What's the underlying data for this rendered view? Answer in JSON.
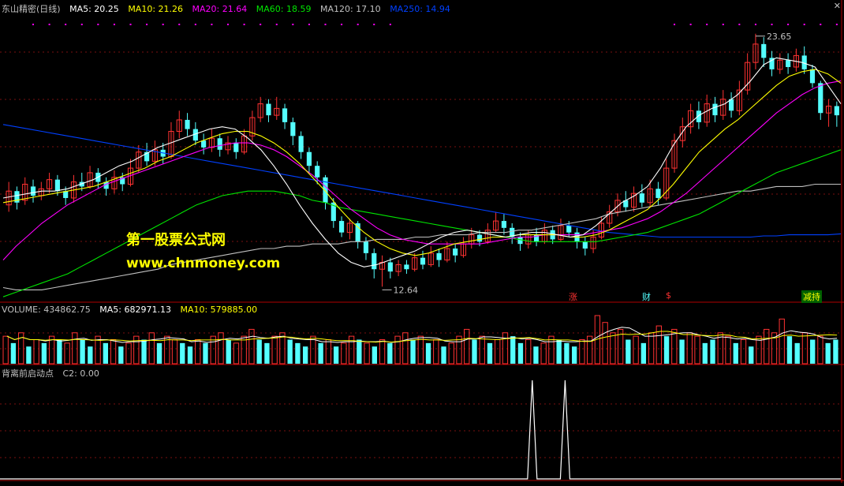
{
  "main_header": {
    "title": "东山精密(日线)",
    "ma5": "MA5: 20.25",
    "ma10": "MA10: 21.26",
    "ma20": "MA20: 21.64",
    "ma60": "MA60: 18.59",
    "ma120": "MA120: 17.10",
    "ma250": "MA250: 14.94"
  },
  "volume_header": {
    "title": "VOLUME: 434862.75",
    "ma5": "MA5: 682971.13",
    "ma10": "MA10: 579885.00"
  },
  "indicator_header": {
    "title": "背离前启动点",
    "c2": "C2: 0.00"
  },
  "watermark": {
    "line1": "第一股票公式网",
    "line2": "www.chnmoney.com"
  },
  "annotations": {
    "high_label": "23.65",
    "low_label": "12.64",
    "tag_zhang": "涨",
    "tag_cai": "财",
    "tag_s": "$",
    "tag_jianchi": "减持"
  },
  "colors": {
    "up": "#ff3232",
    "down": "#54ffff",
    "ma5": "#ffffff",
    "ma10": "#ffff00",
    "ma20": "#ff00ff",
    "ma60": "#00e600",
    "ma120": "#c0c0c0",
    "ma250": "#0040ff",
    "grid": "#7a1010"
  },
  "chart_data": {
    "type": "candlestick",
    "title": "东山精密(日线)",
    "ylim": [
      12.0,
      24.5
    ],
    "high": 23.65,
    "low": 12.64,
    "bars": [
      {
        "o": 16.2,
        "c": 16.8,
        "h": 17.2,
        "l": 15.9
      },
      {
        "o": 16.8,
        "c": 16.3,
        "h": 17.0,
        "l": 16.0
      },
      {
        "o": 16.4,
        "c": 17.1,
        "h": 17.4,
        "l": 16.2
      },
      {
        "o": 17.0,
        "c": 16.6,
        "h": 17.3,
        "l": 16.3
      },
      {
        "o": 16.6,
        "c": 16.9,
        "h": 17.2,
        "l": 16.4
      },
      {
        "o": 16.9,
        "c": 17.3,
        "h": 17.6,
        "l": 16.7
      },
      {
        "o": 17.3,
        "c": 16.8,
        "h": 17.5,
        "l": 16.6
      },
      {
        "o": 16.8,
        "c": 16.5,
        "h": 17.0,
        "l": 16.2
      },
      {
        "o": 16.5,
        "c": 17.2,
        "h": 17.5,
        "l": 16.3
      },
      {
        "o": 17.2,
        "c": 17.0,
        "h": 17.6,
        "l": 16.8
      },
      {
        "o": 17.0,
        "c": 17.6,
        "h": 17.9,
        "l": 16.9
      },
      {
        "o": 17.6,
        "c": 17.2,
        "h": 17.8,
        "l": 16.9
      },
      {
        "o": 17.2,
        "c": 16.9,
        "h": 17.4,
        "l": 16.6
      },
      {
        "o": 16.9,
        "c": 17.4,
        "h": 17.7,
        "l": 16.7
      },
      {
        "o": 17.4,
        "c": 17.1,
        "h": 17.6,
        "l": 16.8
      },
      {
        "o": 17.1,
        "c": 17.8,
        "h": 18.2,
        "l": 17.0
      },
      {
        "o": 17.8,
        "c": 18.5,
        "h": 18.8,
        "l": 17.6
      },
      {
        "o": 18.5,
        "c": 18.1,
        "h": 18.9,
        "l": 17.9
      },
      {
        "o": 18.1,
        "c": 18.6,
        "h": 19.0,
        "l": 17.9
      },
      {
        "o": 18.6,
        "c": 18.3,
        "h": 18.9,
        "l": 18.0
      },
      {
        "o": 18.3,
        "c": 19.4,
        "h": 19.8,
        "l": 18.2
      },
      {
        "o": 19.4,
        "c": 19.9,
        "h": 20.3,
        "l": 19.1
      },
      {
        "o": 19.9,
        "c": 19.5,
        "h": 20.2,
        "l": 19.2
      },
      {
        "o": 19.5,
        "c": 19.0,
        "h": 19.8,
        "l": 18.8
      },
      {
        "o": 19.0,
        "c": 18.7,
        "h": 19.3,
        "l": 18.4
      },
      {
        "o": 18.7,
        "c": 19.1,
        "h": 19.5,
        "l": 18.5
      },
      {
        "o": 19.1,
        "c": 18.6,
        "h": 19.3,
        "l": 18.3
      },
      {
        "o": 18.6,
        "c": 18.9,
        "h": 19.2,
        "l": 18.4
      },
      {
        "o": 18.9,
        "c": 18.5,
        "h": 19.1,
        "l": 18.2
      },
      {
        "o": 18.5,
        "c": 19.2,
        "h": 19.5,
        "l": 18.4
      },
      {
        "o": 19.2,
        "c": 20.0,
        "h": 20.3,
        "l": 19.0
      },
      {
        "o": 20.0,
        "c": 20.6,
        "h": 20.9,
        "l": 19.8
      },
      {
        "o": 20.6,
        "c": 20.1,
        "h": 20.8,
        "l": 19.8
      },
      {
        "o": 20.1,
        "c": 20.4,
        "h": 20.9,
        "l": 19.9
      },
      {
        "o": 20.4,
        "c": 19.8,
        "h": 20.6,
        "l": 19.5
      },
      {
        "o": 19.8,
        "c": 19.2,
        "h": 20.0,
        "l": 18.8
      },
      {
        "o": 19.2,
        "c": 18.5,
        "h": 19.4,
        "l": 18.2
      },
      {
        "o": 18.5,
        "c": 17.9,
        "h": 18.7,
        "l": 17.6
      },
      {
        "o": 17.9,
        "c": 17.4,
        "h": 18.1,
        "l": 17.1
      },
      {
        "o": 17.4,
        "c": 16.3,
        "h": 17.5,
        "l": 16.0
      },
      {
        "o": 16.3,
        "c": 15.5,
        "h": 16.5,
        "l": 15.2
      },
      {
        "o": 15.5,
        "c": 15.0,
        "h": 15.7,
        "l": 14.8
      },
      {
        "o": 15.0,
        "c": 15.4,
        "h": 15.6,
        "l": 14.7
      },
      {
        "o": 15.4,
        "c": 14.6,
        "h": 15.5,
        "l": 14.3
      },
      {
        "o": 14.6,
        "c": 14.1,
        "h": 14.8,
        "l": 13.8
      },
      {
        "o": 14.1,
        "c": 13.4,
        "h": 14.3,
        "l": 13.0
      },
      {
        "o": 13.4,
        "c": 13.7,
        "h": 14.0,
        "l": 12.64
      },
      {
        "o": 13.7,
        "c": 13.3,
        "h": 13.9,
        "l": 13.0
      },
      {
        "o": 13.3,
        "c": 13.6,
        "h": 13.8,
        "l": 13.1
      },
      {
        "o": 13.6,
        "c": 13.4,
        "h": 13.8,
        "l": 13.2
      },
      {
        "o": 13.4,
        "c": 13.9,
        "h": 14.1,
        "l": 13.3
      },
      {
        "o": 13.9,
        "c": 13.6,
        "h": 14.2,
        "l": 13.4
      },
      {
        "o": 13.6,
        "c": 14.1,
        "h": 14.4,
        "l": 13.5
      },
      {
        "o": 14.1,
        "c": 13.8,
        "h": 14.3,
        "l": 13.5
      },
      {
        "o": 13.8,
        "c": 14.3,
        "h": 14.6,
        "l": 13.7
      },
      {
        "o": 14.3,
        "c": 14.0,
        "h": 14.5,
        "l": 13.7
      },
      {
        "o": 14.0,
        "c": 14.5,
        "h": 14.8,
        "l": 13.9
      },
      {
        "o": 14.5,
        "c": 14.9,
        "h": 15.2,
        "l": 14.3
      },
      {
        "o": 14.9,
        "c": 14.6,
        "h": 15.1,
        "l": 14.4
      },
      {
        "o": 14.6,
        "c": 15.1,
        "h": 15.4,
        "l": 14.5
      },
      {
        "o": 15.1,
        "c": 15.5,
        "h": 15.9,
        "l": 15.0
      },
      {
        "o": 15.5,
        "c": 15.2,
        "h": 15.8,
        "l": 14.9
      },
      {
        "o": 15.2,
        "c": 14.8,
        "h": 15.4,
        "l": 14.5
      },
      {
        "o": 14.8,
        "c": 14.5,
        "h": 15.0,
        "l": 14.2
      },
      {
        "o": 14.5,
        "c": 14.9,
        "h": 15.1,
        "l": 14.3
      },
      {
        "o": 14.9,
        "c": 14.6,
        "h": 15.2,
        "l": 14.4
      },
      {
        "o": 14.6,
        "c": 15.1,
        "h": 15.4,
        "l": 14.5
      },
      {
        "o": 15.1,
        "c": 14.7,
        "h": 15.3,
        "l": 14.5
      },
      {
        "o": 14.7,
        "c": 15.3,
        "h": 15.6,
        "l": 14.6
      },
      {
        "o": 15.3,
        "c": 15.0,
        "h": 15.5,
        "l": 14.8
      },
      {
        "o": 15.0,
        "c": 14.6,
        "h": 15.2,
        "l": 14.3
      },
      {
        "o": 14.6,
        "c": 14.3,
        "h": 14.8,
        "l": 14.0
      },
      {
        "o": 14.3,
        "c": 14.8,
        "h": 15.1,
        "l": 14.1
      },
      {
        "o": 14.8,
        "c": 15.4,
        "h": 15.7,
        "l": 14.7
      },
      {
        "o": 15.4,
        "c": 15.9,
        "h": 16.2,
        "l": 15.2
      },
      {
        "o": 15.9,
        "c": 16.4,
        "h": 16.7,
        "l": 15.7
      },
      {
        "o": 16.4,
        "c": 16.1,
        "h": 16.8,
        "l": 15.9
      },
      {
        "o": 16.1,
        "c": 16.7,
        "h": 17.0,
        "l": 15.9
      },
      {
        "o": 16.7,
        "c": 16.3,
        "h": 17.1,
        "l": 16.1
      },
      {
        "o": 16.3,
        "c": 16.9,
        "h": 17.3,
        "l": 16.1
      },
      {
        "o": 16.9,
        "c": 16.5,
        "h": 17.2,
        "l": 16.2
      },
      {
        "o": 16.5,
        "c": 17.8,
        "h": 18.2,
        "l": 16.4
      },
      {
        "o": 17.8,
        "c": 19.0,
        "h": 19.3,
        "l": 17.6
      },
      {
        "o": 19.0,
        "c": 19.6,
        "h": 20.0,
        "l": 18.7
      },
      {
        "o": 19.6,
        "c": 20.3,
        "h": 20.6,
        "l": 19.3
      },
      {
        "o": 20.3,
        "c": 19.8,
        "h": 20.7,
        "l": 19.5
      },
      {
        "o": 19.8,
        "c": 20.6,
        "h": 21.0,
        "l": 19.6
      },
      {
        "o": 20.6,
        "c": 20.1,
        "h": 20.9,
        "l": 19.8
      },
      {
        "o": 20.1,
        "c": 20.8,
        "h": 21.2,
        "l": 19.9
      },
      {
        "o": 20.8,
        "c": 20.3,
        "h": 21.1,
        "l": 20.0
      },
      {
        "o": 20.3,
        "c": 21.2,
        "h": 21.6,
        "l": 20.1
      },
      {
        "o": 21.2,
        "c": 22.4,
        "h": 22.8,
        "l": 21.0
      },
      {
        "o": 22.4,
        "c": 23.2,
        "h": 23.65,
        "l": 22.1
      },
      {
        "o": 23.2,
        "c": 22.6,
        "h": 23.5,
        "l": 22.2
      },
      {
        "o": 22.6,
        "c": 22.1,
        "h": 22.9,
        "l": 21.8
      },
      {
        "o": 22.1,
        "c": 22.5,
        "h": 22.8,
        "l": 21.9
      },
      {
        "o": 22.5,
        "c": 22.2,
        "h": 22.8,
        "l": 21.9
      },
      {
        "o": 22.2,
        "c": 22.7,
        "h": 23.0,
        "l": 22.0
      },
      {
        "o": 22.7,
        "c": 22.1,
        "h": 23.1,
        "l": 21.9
      },
      {
        "o": 22.1,
        "c": 21.5,
        "h": 22.3,
        "l": 21.3
      },
      {
        "o": 21.5,
        "c": 20.2,
        "h": 21.6,
        "l": 19.9
      },
      {
        "o": 20.2,
        "c": 20.5,
        "h": 20.8,
        "l": 19.6
      },
      {
        "o": 20.5,
        "c": 20.1,
        "h": 20.7,
        "l": 19.6
      }
    ],
    "ma_lines": {
      "ma5": [
        16.5,
        16.6,
        16.7,
        16.8,
        16.8,
        16.9,
        17.1,
        17.3,
        17.6,
        17.9,
        18.1,
        18.4,
        18.7,
        18.9,
        19.1,
        19.3,
        19.5,
        19.6,
        19.5,
        19.1,
        18.6,
        17.9,
        17.1,
        16.2,
        15.4,
        14.7,
        14.1,
        13.7,
        13.5,
        13.6,
        13.8,
        14.0,
        14.2,
        14.5,
        14.8,
        15.0,
        15.1,
        15.0,
        14.9,
        14.8,
        14.9,
        15.0,
        15.0,
        14.9,
        14.8,
        14.9,
        15.3,
        15.8,
        16.3,
        16.6,
        17.0,
        17.8,
        18.8,
        19.6,
        20.1,
        20.4,
        20.6,
        21.0,
        21.6,
        22.3,
        22.6,
        22.5,
        22.4,
        22.2,
        21.4,
        20.6
      ],
      "ma10": [
        16.3,
        16.4,
        16.5,
        16.6,
        16.7,
        16.8,
        16.9,
        17.0,
        17.2,
        17.4,
        17.6,
        17.8,
        18.1,
        18.3,
        18.6,
        18.9,
        19.1,
        19.3,
        19.4,
        19.4,
        19.2,
        18.9,
        18.5,
        18.0,
        17.4,
        16.8,
        16.1,
        15.5,
        15.0,
        14.6,
        14.3,
        14.1,
        14.0,
        14.1,
        14.3,
        14.5,
        14.6,
        14.7,
        14.8,
        14.8,
        14.9,
        14.9,
        14.9,
        14.9,
        14.8,
        14.8,
        14.9,
        15.1,
        15.4,
        15.7,
        16.0,
        16.5,
        17.1,
        17.8,
        18.5,
        19.0,
        19.5,
        19.9,
        20.4,
        20.9,
        21.4,
        21.8,
        22.0,
        22.1,
        21.9,
        21.5
      ],
      "ma20": [
        13.8,
        14.4,
        14.9,
        15.4,
        15.8,
        16.2,
        16.5,
        16.8,
        17.1,
        17.3,
        17.5,
        17.7,
        17.9,
        18.1,
        18.3,
        18.5,
        18.7,
        18.8,
        18.9,
        18.9,
        18.8,
        18.6,
        18.3,
        17.9,
        17.5,
        17.0,
        16.5,
        16.0,
        15.6,
        15.2,
        14.9,
        14.7,
        14.6,
        14.5,
        14.5,
        14.5,
        14.5,
        14.5,
        14.6,
        14.7,
        14.8,
        14.8,
        14.9,
        14.9,
        14.9,
        14.9,
        15.0,
        15.1,
        15.2,
        15.4,
        15.6,
        15.9,
        16.3,
        16.7,
        17.2,
        17.7,
        18.2,
        18.7,
        19.2,
        19.7,
        20.2,
        20.6,
        21.0,
        21.3,
        21.5,
        21.6
      ],
      "ma60": [
        12.2,
        12.4,
        12.6,
        12.8,
        13.0,
        13.2,
        13.5,
        13.8,
        14.1,
        14.4,
        14.7,
        15.0,
        15.3,
        15.6,
        15.9,
        16.2,
        16.4,
        16.6,
        16.7,
        16.8,
        16.8,
        16.8,
        16.7,
        16.6,
        16.4,
        16.3,
        16.1,
        16.0,
        15.9,
        15.8,
        15.7,
        15.6,
        15.5,
        15.4,
        15.3,
        15.2,
        15.1,
        15.0,
        14.9,
        14.8,
        14.7,
        14.6,
        14.6,
        14.6,
        14.6,
        14.6,
        14.6,
        14.7,
        14.8,
        14.9,
        15.0,
        15.2,
        15.4,
        15.6,
        15.8,
        16.1,
        16.4,
        16.7,
        17.0,
        17.3,
        17.6,
        17.8,
        18.0,
        18.2,
        18.4,
        18.6
      ],
      "ma120": [
        12.6,
        12.5,
        12.5,
        12.5,
        12.6,
        12.7,
        12.8,
        12.9,
        13.0,
        13.1,
        13.2,
        13.3,
        13.4,
        13.6,
        13.7,
        13.8,
        13.9,
        14.0,
        14.1,
        14.2,
        14.3,
        14.3,
        14.4,
        14.4,
        14.5,
        14.5,
        14.5,
        14.6,
        14.6,
        14.7,
        14.7,
        14.7,
        14.8,
        14.8,
        14.9,
        14.9,
        14.9,
        15.0,
        15.0,
        15.0,
        15.1,
        15.1,
        15.2,
        15.3,
        15.4,
        15.5,
        15.6,
        15.8,
        15.9,
        16.0,
        16.1,
        16.2,
        16.3,
        16.4,
        16.5,
        16.6,
        16.7,
        16.8,
        16.8,
        16.9,
        17.0,
        17.0,
        17.0,
        17.1,
        17.1,
        17.1
      ],
      "ma250": [
        19.7,
        19.6,
        19.5,
        19.4,
        19.3,
        19.2,
        19.1,
        19.0,
        18.9,
        18.8,
        18.7,
        18.6,
        18.5,
        18.4,
        18.3,
        18.2,
        18.1,
        18.0,
        17.9,
        17.8,
        17.7,
        17.6,
        17.5,
        17.4,
        17.3,
        17.2,
        17.1,
        17.0,
        16.9,
        16.8,
        16.7,
        16.6,
        16.5,
        16.4,
        16.3,
        16.2,
        16.1,
        16.0,
        15.9,
        15.8,
        15.7,
        15.6,
        15.5,
        15.4,
        15.3,
        15.2,
        15.1,
        15.0,
        14.95,
        14.9,
        14.85,
        14.8,
        14.8,
        14.8,
        14.8,
        14.8,
        14.8,
        14.8,
        14.8,
        14.85,
        14.85,
        14.9,
        14.9,
        14.9,
        14.9,
        14.94
      ]
    },
    "volume": [
      8,
      6,
      9,
      5,
      7,
      6,
      8,
      7,
      6,
      9,
      7,
      5,
      8,
      6,
      7,
      5,
      6,
      8,
      7,
      9,
      6,
      8,
      7,
      6,
      5,
      7,
      6,
      8,
      9,
      7,
      6,
      8,
      10,
      7,
      6,
      8,
      9,
      7,
      6,
      5,
      8,
      6,
      7,
      5,
      6,
      8,
      7,
      6,
      5,
      7,
      6,
      8,
      9,
      7,
      8,
      6,
      7,
      5,
      6,
      8,
      10,
      7,
      8,
      6,
      7,
      9,
      8,
      6,
      7,
      5,
      6,
      8,
      7,
      6,
      5,
      7,
      8,
      14,
      12,
      9,
      10,
      7,
      8,
      6,
      9,
      11,
      8,
      10,
      7,
      9,
      8,
      6,
      7,
      9,
      8,
      6,
      7,
      5,
      8,
      10,
      9,
      13,
      8,
      6,
      9,
      7,
      8,
      6,
      7
    ],
    "volume_up": [
      1,
      0,
      1,
      0,
      1,
      0,
      1,
      0,
      1,
      1,
      0,
      0,
      1,
      0,
      1,
      0,
      1,
      1,
      0,
      1,
      0,
      1,
      1,
      0,
      0,
      1,
      0,
      1,
      1,
      0,
      1,
      1,
      1,
      0,
      0,
      1,
      1,
      0,
      0,
      0,
      1,
      0,
      1,
      0,
      1,
      1,
      0,
      1,
      0,
      1,
      0,
      1,
      1,
      0,
      1,
      0,
      1,
      0,
      1,
      1,
      1,
      0,
      1,
      0,
      1,
      1,
      0,
      0,
      1,
      0,
      1,
      1,
      0,
      0,
      0,
      1,
      1,
      1,
      1,
      1,
      1,
      0,
      1,
      0,
      1,
      1,
      0,
      1,
      0,
      1,
      1,
      0,
      0,
      1,
      1,
      0,
      1,
      0,
      1,
      1,
      1,
      1,
      0,
      0,
      1,
      0,
      1,
      0,
      0
    ],
    "vol_ylim": [
      0,
      14
    ],
    "indicator": {
      "name": "C2",
      "value": 0.0,
      "spikes_at_fraction": [
        0.633,
        0.672
      ]
    }
  }
}
